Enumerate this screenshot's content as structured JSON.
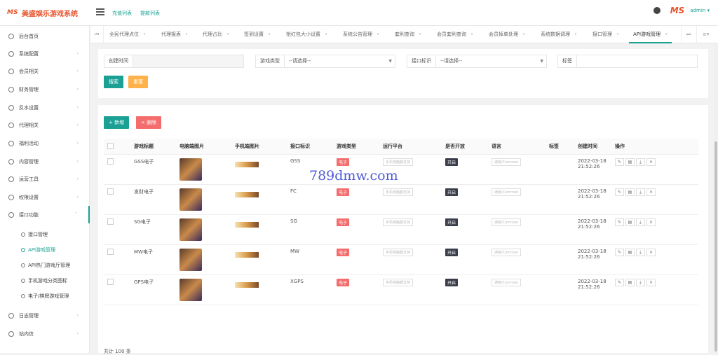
{
  "app": {
    "logo_mark": "MS",
    "title": "美盛娱乐游戏系统"
  },
  "topbar": {
    "links": [
      "充值列表",
      "提款列表"
    ],
    "brand": "MS",
    "user": "admin ▾"
  },
  "sidebar": {
    "items": [
      {
        "label": "后台首页"
      },
      {
        "label": "系统配置"
      },
      {
        "label": "会员相关"
      },
      {
        "label": "财务管理"
      },
      {
        "label": "反水设置"
      },
      {
        "label": "代理相关"
      },
      {
        "label": "福利活动"
      },
      {
        "label": "内容管理"
      },
      {
        "label": "运营工具"
      },
      {
        "label": "权限设置"
      },
      {
        "label": "接口功能"
      }
    ],
    "sub_items": [
      {
        "label": "接口管理"
      },
      {
        "label": "API游戏管理"
      },
      {
        "label": "API热门游戏厅管理"
      },
      {
        "label": "手机游戏分类图标"
      },
      {
        "label": "电子/棋牌游戏管理"
      }
    ],
    "bottom_items": [
      {
        "label": "日志管理"
      },
      {
        "label": "站内信"
      }
    ]
  },
  "tabs": [
    "全民代理点位",
    "代理报表",
    "代理占比",
    "签到设置",
    "抢红包大小设置",
    "系统公告管理",
    "套利查询",
    "会员套利查询",
    "会员掉单处理",
    "系统数据调理",
    "接口管理",
    "API游戏管理"
  ],
  "filter": {
    "created_label": "创建时间",
    "type_label": "游戏类型",
    "type_value": "--请选择--",
    "iface_label": "接口标识",
    "iface_value": "--请选择--",
    "tag_label": "标签",
    "search": "搜索",
    "reset": "重置"
  },
  "actions": {
    "add": "+ 新增",
    "delete": "× 删除"
  },
  "table": {
    "headers": [
      "游戏标题",
      "电脑端图片",
      "手机端图片",
      "接口标识",
      "游戏类型",
      "运行平台",
      "是否开放",
      "语言",
      "标签",
      "创建时间",
      "操作"
    ],
    "rows": [
      {
        "title": "GSS电子",
        "iface": "GSS",
        "type": "电子",
        "platform": "手机电脑都支持",
        "open": "开启",
        "lang": "通用/Common",
        "date": "2022-03-18",
        "time": "21:52:26"
      },
      {
        "title": "发财电子",
        "iface": "FC",
        "type": "电子",
        "platform": "手机电脑都支持",
        "open": "开启",
        "lang": "通用/Common",
        "date": "2022-03-18",
        "time": "21:52:26"
      },
      {
        "title": "SG电子",
        "iface": "SG",
        "type": "电子",
        "platform": "手机电脑都支持",
        "open": "开启",
        "lang": "通用/Common",
        "date": "2022-03-18",
        "time": "21:52:26"
      },
      {
        "title": "MW电子",
        "iface": "MW",
        "type": "电子",
        "platform": "手机电脑都支持",
        "open": "开启",
        "lang": "通用/Common",
        "date": "2022-03-18",
        "time": "21:52:26"
      },
      {
        "title": "GPS电子",
        "iface": "XGPS",
        "type": "电子",
        "platform": "手机电脑都支持",
        "open": "开启",
        "lang": "通用/Common",
        "date": "2022-03-18",
        "time": "21:52:26"
      }
    ]
  },
  "watermark": "789dmw.com",
  "footer": "共计 100 条"
}
